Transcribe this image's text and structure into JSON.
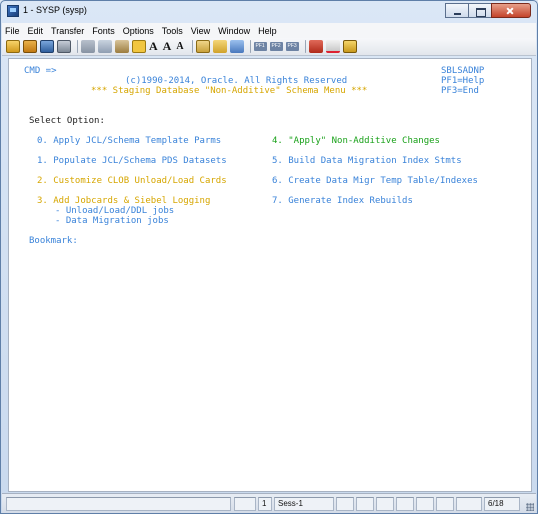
{
  "window": {
    "title": "1 - SYSP (sysp)"
  },
  "menubar": {
    "items": [
      "File",
      "Edit",
      "Transfer",
      "Fonts",
      "Options",
      "Tools",
      "View",
      "Window",
      "Help"
    ]
  },
  "toolbar": {
    "icons": [
      "new-session-icon",
      "open-icon",
      "save-icon",
      "print-icon",
      "cut-icon",
      "copy-icon",
      "paste-icon",
      "selected-icon",
      "font-icon",
      "font-larger-icon",
      "font-smaller-icon",
      "keyboard-icon",
      "send-icon",
      "receive-icon",
      "pf1-icon",
      "pf2-icon",
      "pf3-icon",
      "enter-icon",
      "check-icon",
      "macro-icon"
    ],
    "font_a": "A",
    "font_a2": "A",
    "font_a3": "A",
    "pf_labels": [
      "PF1",
      "PF2",
      "PF3"
    ]
  },
  "terminal": {
    "cmd": "CMD =>",
    "panel_id": "SBLSADNP",
    "copyright": "(c)1990-2014, Oracle. All Rights Reserved",
    "pf1": "PF1=Help",
    "menu_title": "*** Staging Database \"Non-Additive\" Schema Menu ***",
    "pf3": "PF3=End",
    "select_option": "Select Option:",
    "options": {
      "o0": "0. Apply JCL/Schema Template Parms",
      "o1": "1. Populate JCL/Schema PDS Datasets",
      "o2": "2. Customize CLOB Unload/Load Cards",
      "o3": "3. Add Jobcards & Siebel Logging",
      "o3a": "- Unload/Load/DDL jobs",
      "o3b": "- Data Migration jobs",
      "o4": "4. \"Apply\" Non-Additive Changes",
      "o5": "5. Build Data Migration Index Stmts",
      "o6": "6. Create Data Migr Temp Table/Indexes",
      "o7": "7. Generate Index Rebuilds"
    },
    "bookmark": "Bookmark:"
  },
  "status": {
    "session_num": "1",
    "session_name": "Sess-1",
    "cursor": "6/18"
  },
  "colors": {
    "field_blue": "#3a83d9",
    "highlight_yellow": "#d6a600",
    "highlight_green": "#1aa11a"
  }
}
